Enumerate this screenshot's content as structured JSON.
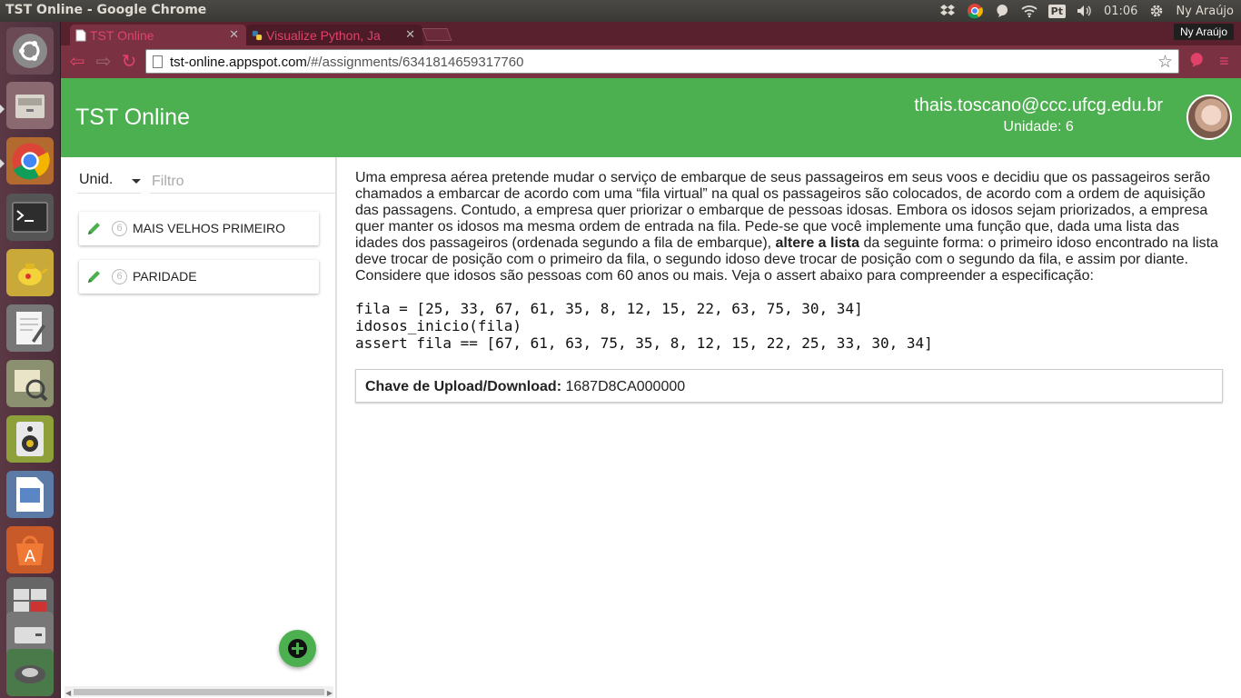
{
  "os": {
    "window_title": "TST Online - Google Chrome",
    "tray": {
      "keyboard_layout": "Pt",
      "time": "01:06",
      "user": "Ny Araújo"
    },
    "launcher": [
      "dash-icon",
      "files-icon",
      "chrome-icon",
      "terminal-icon",
      "teapot-icon",
      "text-editor-icon",
      "image-viewer-icon",
      "speaker-icon",
      "writer-icon",
      "software-center-icon",
      "workspaces-icon",
      "drive-icon",
      "trash-icon"
    ]
  },
  "browser": {
    "tabs": [
      {
        "title": "TST Online",
        "active": true
      },
      {
        "title": "Visualize Python, Ja",
        "active": false
      }
    ],
    "profile_badge": "Ny Araújo",
    "url_host": "tst-online.appspot.com",
    "url_path": "/#/assignments/6341814659317760"
  },
  "app": {
    "brand": "TST Online",
    "user_email": "thais.toscano@ccc.ufcg.edu.br",
    "unit_label": "Unidade: 6",
    "accent_color": "#4caf50"
  },
  "sidebar": {
    "unit_select": "Unid.",
    "filter_placeholder": "Filtro",
    "assignments": [
      {
        "unit": "6",
        "title": "MAIS VELHOS PRIMEIRO"
      },
      {
        "unit": "6",
        "title": "PARIDADE"
      }
    ],
    "add_button_icon": "plus-icon"
  },
  "assignment": {
    "description_before": "Uma empresa aérea pretende mudar o serviço de embarque de seus passageiros em seus voos e decidiu que os passageiros serão chamados a embarcar de acordo com uma “fila virtual” na qual os passageiros são colocados, de acordo com a ordem de aquisição das passagens. Contudo, a empresa quer priorizar o embarque de pessoas idosas. Embora os idosos sejam priorizados, a empresa quer manter os idosos ma mesma ordem de entrada na fila. Pede-se que você implemente uma função que, dada uma lista das idades dos passageiros (ordenada segundo a fila de embarque), ",
    "description_bold": "altere a lista",
    "description_after": " da seguinte forma: o primeiro idoso encontrado na lista deve trocar de posição com o primeiro da fila, o segundo idoso deve trocar de posição com o segundo da fila, e assim por diante. Considere que idosos são pessoas com 60 anos ou mais. Veja o assert abaixo para compreender a especificação:",
    "code_lines": [
      "fila = [25, 33, 67, 61, 35, 8, 12, 15, 22, 63, 75, 30, 34]",
      "idosos_inicio(fila)",
      "assert fila == [67, 61, 63, 75, 35, 8, 12, 15, 22, 25, 33, 30, 34]"
    ],
    "key_label": "Chave de Upload/Download:",
    "key_value": "1687D8CA000000"
  }
}
